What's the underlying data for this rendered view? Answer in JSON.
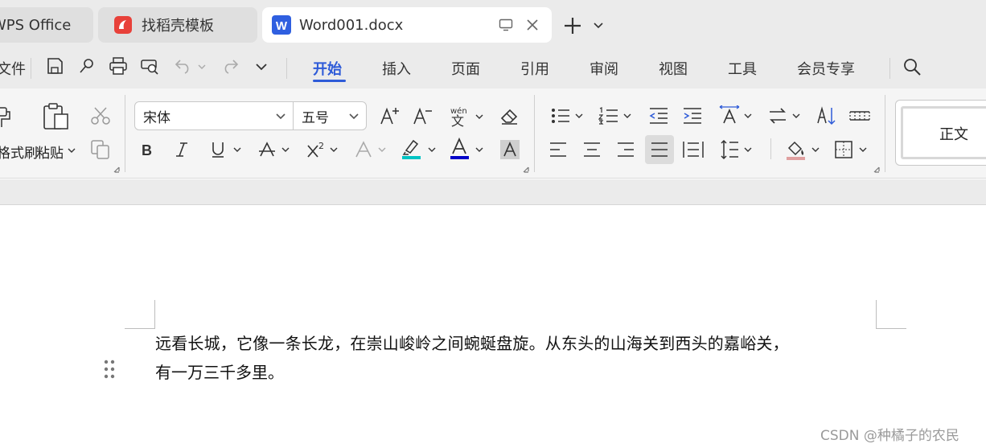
{
  "tabs": [
    {
      "label": "WPS Office"
    },
    {
      "label": "找稻壳模板"
    },
    {
      "label": "Word001.docx"
    }
  ],
  "menu": {
    "file": "文件",
    "tabs": [
      "开始",
      "插入",
      "页面",
      "引用",
      "审阅",
      "视图",
      "工具",
      "会员专享"
    ]
  },
  "ribbon": {
    "format_painter": "格式刷",
    "paste": "粘贴",
    "font_name": "宋体",
    "font_size": "五号",
    "style_normal": "正文"
  },
  "document": {
    "line1": "远看长城，它像一条长龙，在崇山峻岭之间蜿蜒盘旋。从东头的山海关到西头的嘉峪关，",
    "line2": "有一万三千多里。"
  },
  "watermark": "CSDN @种橘子的农民",
  "colors": {
    "accent": "#2e5bd8",
    "highlight": "#00c3c3",
    "font_color": "#0000c8",
    "wps_logo": "#e8413a",
    "word_icon": "#2f5fe0"
  }
}
